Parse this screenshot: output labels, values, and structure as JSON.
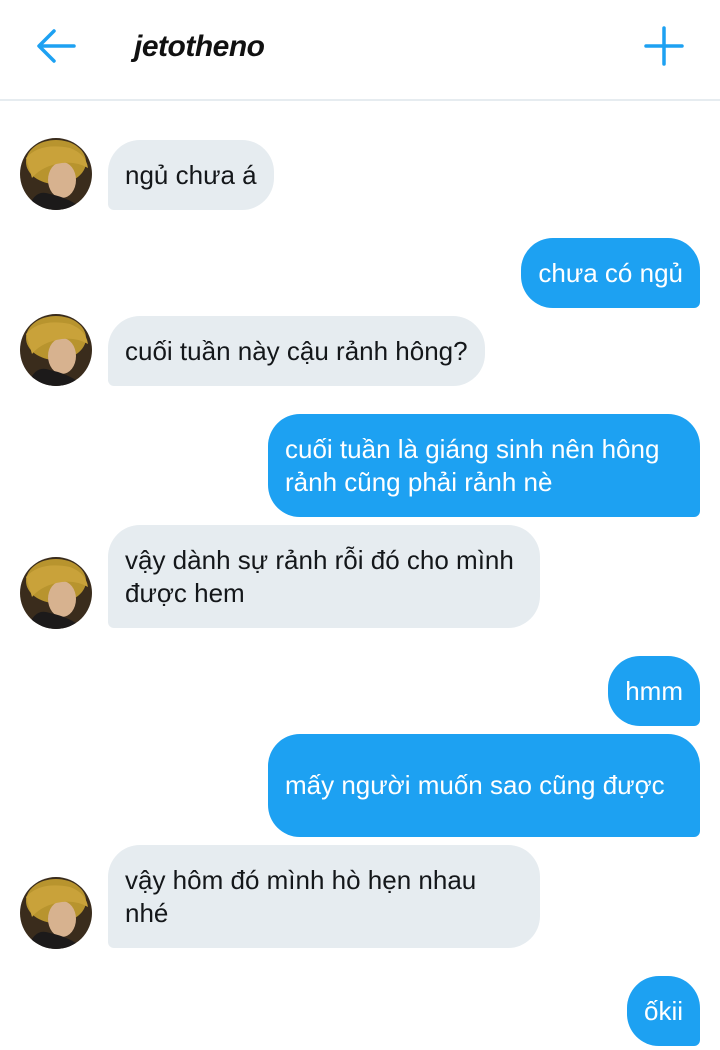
{
  "header": {
    "title": "jetotheno",
    "back_icon": "arrow-left-icon",
    "add_icon": "plus-icon",
    "accent_color": "#1da1f2"
  },
  "messages": [
    {
      "from": "them",
      "text": "ngủ chưa á"
    },
    {
      "from": "me",
      "text": "chưa có ngủ"
    },
    {
      "from": "them",
      "text": "cuối tuần này cậu rảnh hông?"
    },
    {
      "from": "me",
      "text": "cuối tuần là giáng sinh nên hông rảnh cũng phải rảnh nè"
    },
    {
      "from": "them",
      "text": "vậy dành sự rảnh rỗi đó cho mình được hem"
    },
    {
      "from": "me",
      "text": "hmm"
    },
    {
      "from": "me",
      "text": "mấy người muốn sao cũng được"
    },
    {
      "from": "them",
      "text": "vậy hôm đó mình hò hẹn nhau nhé"
    },
    {
      "from": "me",
      "text": "ốkii"
    }
  ],
  "colors": {
    "incoming_bubble": "#e6ecf0",
    "outgoing_bubble": "#1da1f2"
  }
}
